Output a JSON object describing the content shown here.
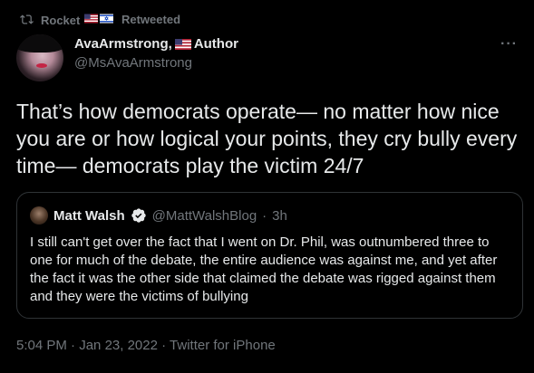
{
  "retweet": {
    "user": "Rocket",
    "label": "Retweeted"
  },
  "author": {
    "name": "AvaArmstrong, ",
    "name_suffix": "Author",
    "handle": "@MsAvaArmstrong"
  },
  "tweet": {
    "text": "That’s how democrats operate— no matter how nice you are or how logical your points, they cry bully every time— democrats play the victim 24/7"
  },
  "quote": {
    "name": "Matt Walsh",
    "handle": "@MattWalshBlog",
    "separator": " · ",
    "time": "3h",
    "text": "I still can't get over the fact that I went on Dr. Phil, was outnumbered three to one for much of the debate, the entire audience was against me, and yet after the fact it was the other side that claimed the debate was rigged against them and they were the victims of bullying"
  },
  "meta": {
    "time": "5:04 PM",
    "separator1": " · ",
    "date": "Jan 23, 2022",
    "separator2": " · ",
    "source": "Twitter for iPhone"
  },
  "colors": {
    "background": "#000000",
    "text": "#e7e9ea",
    "muted": "#71767b",
    "verified": "#1d9bf0",
    "border": "#2f3336"
  },
  "icons": {
    "retweet": "retweet-icon",
    "more": "more-icon",
    "verified": "verified-badge-icon"
  }
}
